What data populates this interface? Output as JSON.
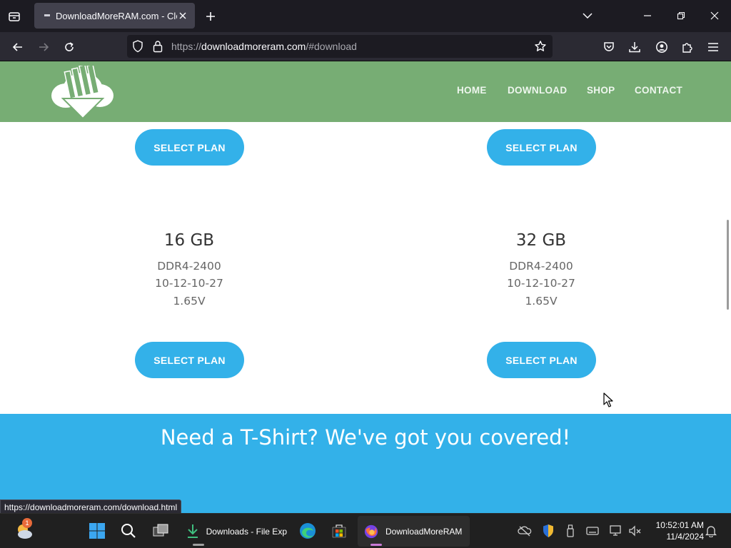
{
  "browser": {
    "tab": {
      "title": "DownloadMoreRAM.com - Cloud",
      "close_label": "✕"
    },
    "url": {
      "scheme": "https://",
      "host": "downloadmoreram.com",
      "path": "/#download"
    },
    "status_url": "https://downloadmoreram.com/download.html"
  },
  "site": {
    "menu": [
      "HOME",
      "DOWNLOAD",
      "SHOP",
      "CONTACT"
    ],
    "plans_top": [
      {
        "button": "SELECT PLAN"
      },
      {
        "button": "SELECT PLAN"
      }
    ],
    "plans": [
      {
        "size": "16 GB",
        "type": "DDR4-2400",
        "timings": "10-12-10-27",
        "voltage": "1.65V",
        "button": "SELECT PLAN"
      },
      {
        "size": "32 GB",
        "type": "DDR4-2400",
        "timings": "10-12-10-27",
        "voltage": "1.65V",
        "button": "SELECT PLAN"
      }
    ],
    "tshirt_heading": "Need a T-Shirt? We've got you covered!"
  },
  "taskbar": {
    "weather_badge": "1",
    "apps": [
      {
        "label": "Downloads - File Exp"
      },
      {
        "label": "DownloadMoreRAM"
      }
    ],
    "clock": {
      "time": "10:52:01 AM",
      "date": "11/4/2024"
    }
  },
  "colors": {
    "header_green": "#77ad74",
    "accent_blue": "#33b1e9",
    "browser_dark": "#1c1b22"
  }
}
